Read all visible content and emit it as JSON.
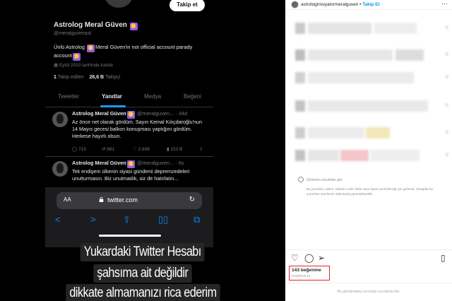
{
  "twitter": {
    "profile": {
      "name": "Astrolog Meral Güven",
      "badge": "♊",
      "handle": "@meralguvenast",
      "follow_label": "Takip et",
      "bio_a": "Ünlü Astrolog ",
      "bio_b": "Meral Güven'in not official account parady account",
      "joined": "Eylül 2010 tarihinde katıldı",
      "following_count": "1",
      "following_label": "Takip edilen",
      "followers_count": "26,6 B",
      "followers_label": "Takipçi"
    },
    "tabs": [
      {
        "label": "Tweetler"
      },
      {
        "label": "Yanıtlar"
      },
      {
        "label": "Medya"
      },
      {
        "label": "Beğeni"
      }
    ],
    "tweets": [
      {
        "name": "Astrolog Meral Güven",
        "handle": "@meralguven...",
        "time": "· 34d",
        "text": "Az önce net olarak gördüm. Sayın Kemal Kılıçdaroğlu'nun 14 Mayıs gecesi balkon konuşması yaptığını gördüm. Herkese hayırlı olsun.",
        "replies": "719",
        "retweets": "881",
        "likes": "2.608",
        "views": "153 B"
      },
      {
        "name": "Astrolog Meral Güven",
        "handle": "@meralguven...",
        "time": "· 6s",
        "text": "Tek endişem ülkenin siyasi gündemi depremzedeleri unutturmasın. Biz unutmadık, siz de hatırlatın..."
      }
    ]
  },
  "safari": {
    "aa_label": "AA",
    "url": "twitter.com",
    "nav_icons": [
      "back-icon",
      "forward-icon",
      "share-icon",
      "bookmarks-icon",
      "tabs-icon"
    ]
  },
  "caption": {
    "line1": "Yukardaki Twitter Hesabı",
    "line2": "şahsıma ait değildir",
    "line3": "dikkate almamanızı rica ederim"
  },
  "instagram": {
    "username": "astrologinisiyatormeralguven",
    "dot": "•",
    "follow_label": "Takip Et",
    "more": "···",
    "hidden_toggle": "Gizlenen yorumları gör",
    "hidden_note": "Bu yorumlar, şiirleri, rahatsız edici ifade veya spam içerebileceği için gizlendi. Hesaplar bu yorumları üzerlerine dokunarak görüntüleyebilir.",
    "likes": "143 beğenme",
    "date": "HAZİRAN 12",
    "comments_off": "Bu gönderideki yorumlar sınırlandırıldı."
  }
}
